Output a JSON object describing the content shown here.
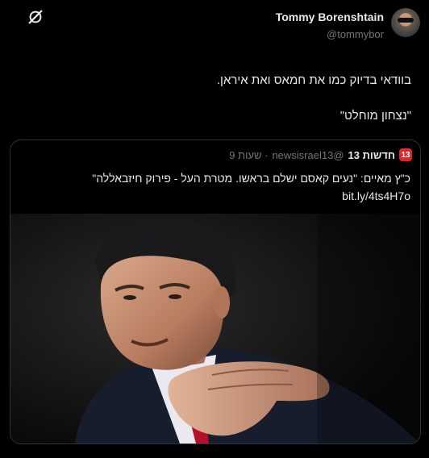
{
  "author": {
    "name": "Tommy Borenshtain",
    "handle": "@tommybor"
  },
  "tweet": {
    "line1": "בוודאי בדיוק כמו את חמאס ואת איראן.",
    "line2": "\"נצחון מוחלט\""
  },
  "quote": {
    "logo_text": "13",
    "source_name": "חדשות 13",
    "handle": "@newsisrael13",
    "time": "· שעות 9",
    "text": "כ\"ץ מאיים: \"נעים קאסם ישלם בראשו. מטרת העל - פירוק חיזבאללה\"",
    "link": "bit.ly/4ts4H7o"
  },
  "icons": {
    "header_icon": "grok-icon"
  },
  "colors": {
    "background": "#000000",
    "text": "#e7e9ea",
    "secondary": "#71767b",
    "border": "#2f3336",
    "logo_red": "#e0262c"
  }
}
